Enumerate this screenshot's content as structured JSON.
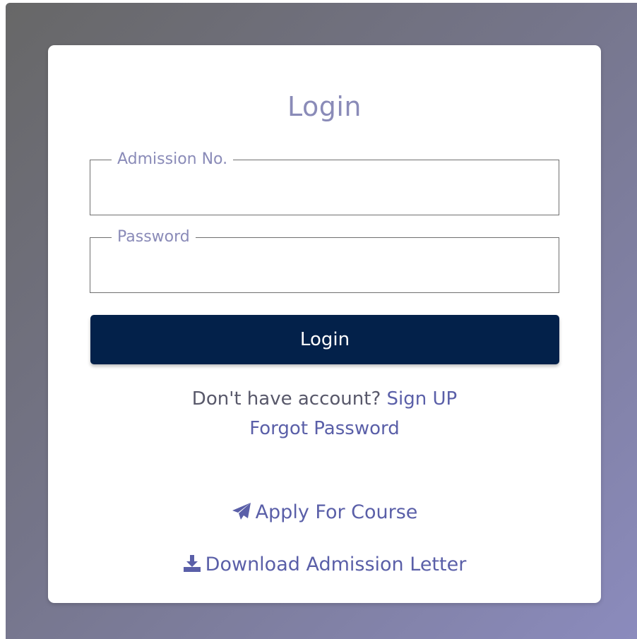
{
  "login_form": {
    "title": "Login",
    "admission_field": {
      "label": "Admission No.",
      "value": ""
    },
    "password_field": {
      "label": "Password",
      "value": ""
    },
    "login_button": "Login",
    "signup_prompt": "Don't have account?",
    "signup_link": "Sign UP",
    "forgot_password_link": "Forgot Password",
    "apply_link": "Apply For Course",
    "download_link": "Download Admission Letter"
  },
  "icons": {
    "apply": "paper-plane-icon",
    "download": "download-icon"
  },
  "colors": {
    "primary_button": "#03214a",
    "link": "#5a5fa8",
    "label": "#8a8bb8",
    "text": "#58586a"
  }
}
